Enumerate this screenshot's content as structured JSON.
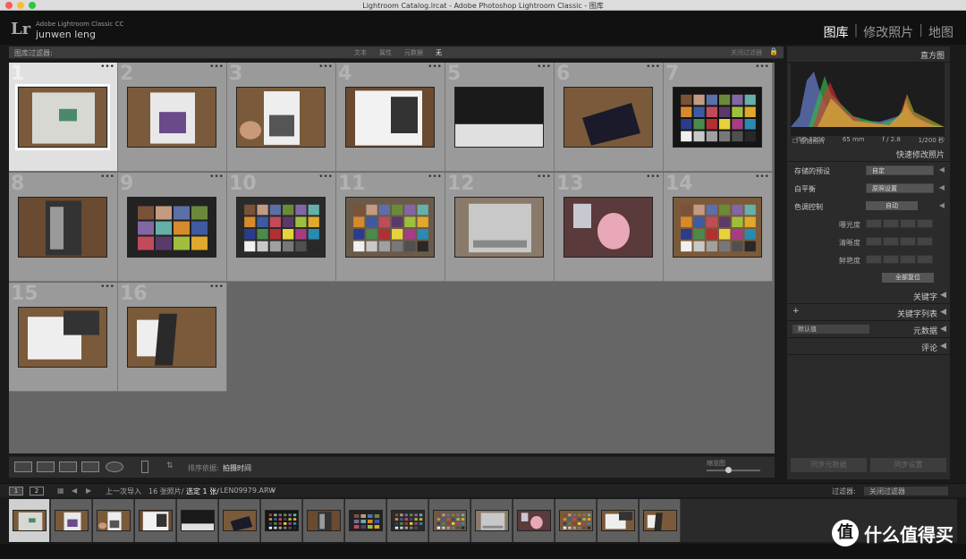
{
  "window": {
    "title": "Lightroom Catalog.lrcat - Adobe Photoshop Lightroom Classic - 图库"
  },
  "header": {
    "logo": "Lr",
    "brand": "Adobe Lightroom Classic CC",
    "user": "junwen leng",
    "modules": [
      {
        "label": "图库",
        "active": true
      },
      {
        "label": "修改照片",
        "active": false
      },
      {
        "label": "地图",
        "active": false
      }
    ]
  },
  "filter": {
    "label": "图库过滤器:",
    "options": [
      "文本",
      "属性",
      "元数据",
      "无"
    ],
    "close": "关闭过滤器"
  },
  "grid": {
    "cells": [
      {
        "num": "1",
        "selected": true,
        "scene": "bag"
      },
      {
        "num": "2",
        "selected": false,
        "scene": "box"
      },
      {
        "num": "3",
        "selected": false,
        "scene": "box-hand"
      },
      {
        "num": "4",
        "selected": false,
        "scene": "open-box"
      },
      {
        "num": "5",
        "selected": false,
        "scene": "dark"
      },
      {
        "num": "6",
        "selected": false,
        "scene": "booklet"
      },
      {
        "num": "7",
        "selected": false,
        "scene": "checker"
      },
      {
        "num": "8",
        "selected": false,
        "scene": "gray-card"
      },
      {
        "num": "9",
        "selected": false,
        "scene": "checker-close"
      },
      {
        "num": "10",
        "selected": false,
        "scene": "checker-tilt"
      },
      {
        "num": "11",
        "selected": false,
        "scene": "checker-hand"
      },
      {
        "num": "12",
        "selected": false,
        "scene": "gray-chart"
      },
      {
        "num": "13",
        "selected": false,
        "scene": "teapot"
      },
      {
        "num": "14",
        "selected": false,
        "scene": "checker-table"
      },
      {
        "num": "15",
        "selected": false,
        "scene": "checker-box"
      },
      {
        "num": "16",
        "selected": false,
        "scene": "dark-flip"
      }
    ]
  },
  "toolbar": {
    "sort_label": "排序依据:",
    "sort_value": "拍摄时间",
    "thumb_label": "缩览图",
    "thumb_level": 0.4
  },
  "histogram": {
    "title": "直方图",
    "iso": "ISO 3200",
    "focal": "65 mm",
    "aperture": "f / 2.8",
    "shutter": "1/200 秒",
    "original": "原始照片"
  },
  "quick_develop": {
    "title": "快速修改照片",
    "preset_label": "存储的预设",
    "preset_value": "自定",
    "wb_label": "白平衡",
    "wb_value": "原照设置",
    "tone_label": "色调控制",
    "tone_value": "自动",
    "exposure": "曝光度",
    "clarity": "清晰度",
    "vibrance": "鲜艳度",
    "reset": "全部复位"
  },
  "panels": {
    "keyword": "关键字",
    "keyword_list": "关键字列表",
    "metadata": "元数据",
    "metadata_value": "默认值",
    "comment": "评论",
    "sync_meta": "同步元数据",
    "sync_settings": "同步设置"
  },
  "filmbar": {
    "page1": "1",
    "page2": "2",
    "prev_import": "上一次导入",
    "count": "16 张照片/",
    "selected": "选定 1 张/",
    "file": "LEN09979.ARW",
    "filter_label": "过滤器:",
    "filter_value": "关闭过滤器"
  },
  "watermark": {
    "symbol": "值",
    "text": "什么值得买"
  }
}
